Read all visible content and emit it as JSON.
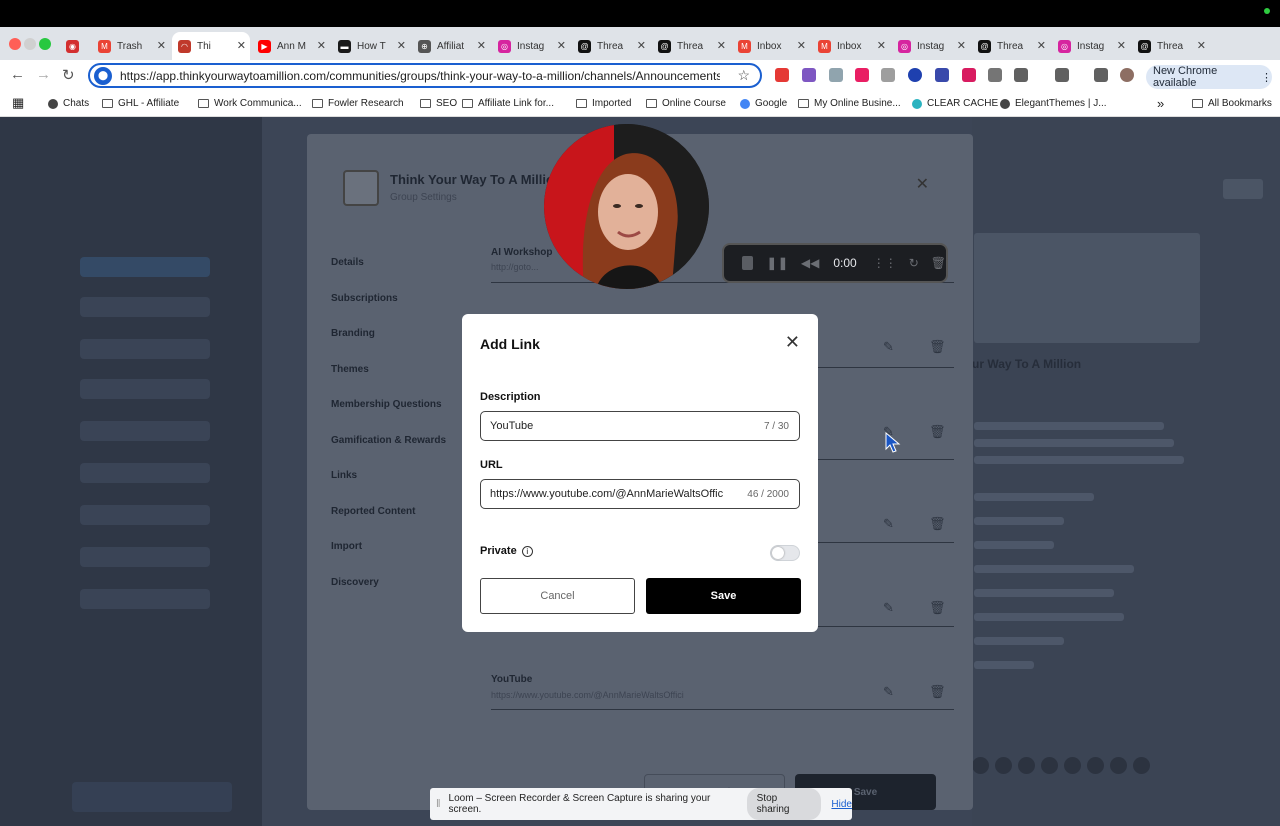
{
  "browser": {
    "tabs": [
      {
        "title": "",
        "icon": "record-icon",
        "color": "#d32f2f"
      },
      {
        "title": "Trash",
        "icon": "gmail-icon",
        "color": "#ea4335"
      },
      {
        "title": "Thi",
        "icon": "community-icon",
        "color": "#c0392b",
        "active": true
      },
      {
        "title": "Ann M",
        "icon": "youtube-icon",
        "color": "#ff0000"
      },
      {
        "title": "How T",
        "icon": "site-icon",
        "color": "#1a1a1a"
      },
      {
        "title": "Affiliat",
        "icon": "globe-icon",
        "color": "#555555"
      },
      {
        "title": "Instag",
        "icon": "instagram-icon",
        "color": "#d6249f"
      },
      {
        "title": "Threa",
        "icon": "threads-icon",
        "color": "#111111"
      },
      {
        "title": "Threa",
        "icon": "threads-icon",
        "color": "#111111"
      },
      {
        "title": "Inbox",
        "icon": "gmail-icon",
        "color": "#ea4335"
      },
      {
        "title": "Inbox",
        "icon": "gmail-icon",
        "color": "#ea4335"
      },
      {
        "title": "Instag",
        "icon": "instagram-icon",
        "color": "#d6249f"
      },
      {
        "title": "Threa",
        "icon": "threads-icon",
        "color": "#111111"
      },
      {
        "title": "Instag",
        "icon": "instagram-icon",
        "color": "#d6249f"
      },
      {
        "title": "Threa",
        "icon": "threads-icon",
        "color": "#111111"
      }
    ],
    "url": "https://app.thinkyourwaytoamillion.com/communities/groups/think-your-way-to-a-million/channels/Announcements-8kG7ru",
    "new_chrome": "New Chrome available",
    "bookmarks": [
      "Chats",
      "GHL - Affiliate",
      "Work Communica...",
      "Fowler Research",
      "SEO",
      "Affiliate Link for...",
      "Imported",
      "Online Course",
      "Google",
      "My Online Busine...",
      "CLEAR CACHE",
      "ElegantThemes | J..."
    ],
    "all_bookmarks": "All Bookmarks",
    "more": "»"
  },
  "settings": {
    "group_name": "Think Your Way To A Million",
    "subtitle": "Group Settings",
    "nav": [
      "Details",
      "Subscriptions",
      "Branding",
      "Themes",
      "Membership Questions",
      "Gamification & Rewards",
      "Links",
      "Reported Content",
      "Import",
      "Discovery"
    ],
    "ai_workshop": "AI Workshop",
    "ai_workshop_url": "http://goto...",
    "youtube_label": "YouTube",
    "youtube_url": "https://www.youtube.com/@AnnMarieWaltsOffici",
    "bg_cancel": "Cancel",
    "bg_save": "Save"
  },
  "recorder": {
    "time": "0:00"
  },
  "modal": {
    "title": "Add Link",
    "description_label": "Description",
    "description_value": "YouTube",
    "description_count": "7 / 30",
    "url_label": "URL",
    "url_value": "https://www.youtube.com/@AnnMarieWaltsOffic",
    "url_count": "46 / 2000",
    "private_label": "Private",
    "private_enabled": false,
    "cancel_label": "Cancel",
    "save_label": "Save"
  },
  "right_panel": {
    "title": "ur Way To A Million"
  },
  "loom": {
    "message": "Loom – Screen Recorder & Screen Capture is sharing your screen.",
    "stop_label": "Stop sharing",
    "hide_label": "Hide"
  }
}
